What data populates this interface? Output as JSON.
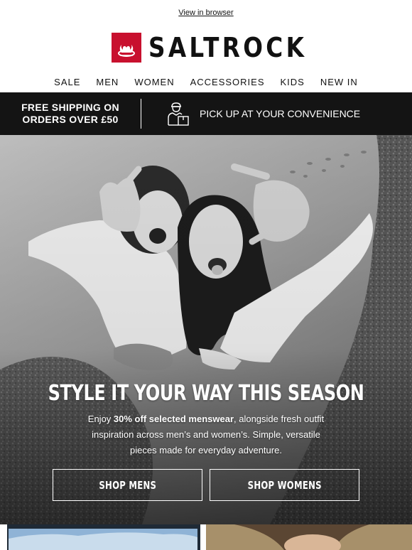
{
  "header": {
    "view_in_browser": "View in browser",
    "brand": "SALTROCK",
    "brand_color": "#c8102e"
  },
  "nav": {
    "items": [
      "SALE",
      "MEN",
      "WOMEN",
      "ACCESSORIES",
      "KIDS",
      "NEW IN"
    ]
  },
  "banner": {
    "shipping_line1": "FREE SHIPPING ON",
    "shipping_line2": "ORDERS OVER £50",
    "pickup_icon": "delivery-person-icon",
    "pickup_text": "PICK UP AT YOUR CONVENIENCE"
  },
  "hero": {
    "title": "STYLE IT YOUR WAY THIS SEASON",
    "body_prefix": "Enjoy ",
    "body_bold": "30% off selected menswear",
    "body_suffix": ", alongside fresh outfit inspiration across men’s and women’s.  Simple, versatile pieces made for everyday adventure.",
    "buttons": [
      "SHOP MENS",
      "SHOP WOMENS"
    ]
  }
}
